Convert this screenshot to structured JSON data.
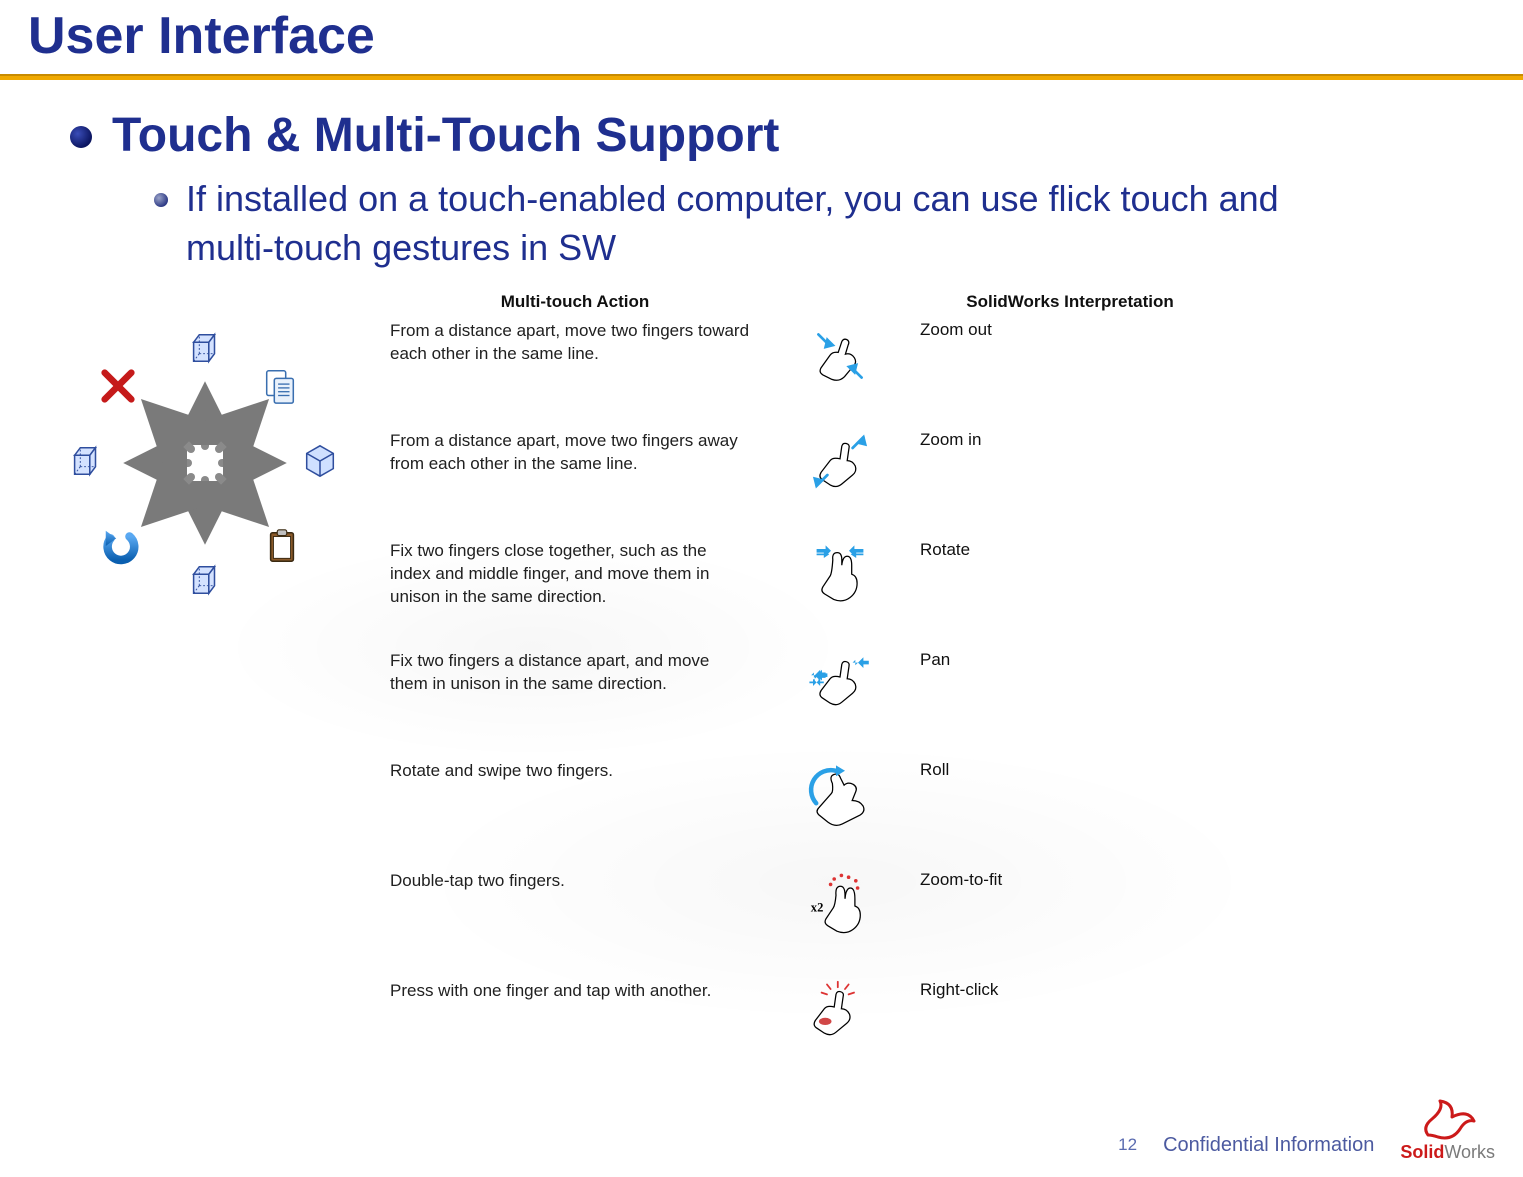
{
  "title": "User Interface",
  "section_heading": "Touch & Multi-Touch Support",
  "sub_bullet": "If installed on a touch-enabled computer, you can use flick touch and multi-touch gestures in SW",
  "table": {
    "header_action": "Multi-touch Action",
    "header_interpret": "SolidWorks Interpretation",
    "rows": [
      {
        "action": "From a distance apart, move two fingers toward each other in the same line.",
        "gesture": "pinch-in",
        "interpret": "Zoom out"
      },
      {
        "action": "From a distance apart, move two fingers away from each other in the same line.",
        "gesture": "pinch-out",
        "interpret": "Zoom in"
      },
      {
        "action": "Fix two fingers close together, such as the index and middle finger, and move them in unison in the same direction.",
        "gesture": "two-finger-drag-close",
        "interpret": "Rotate"
      },
      {
        "action": "Fix two fingers a distance apart, and move them in unison in the same direction.",
        "gesture": "two-finger-drag-apart",
        "interpret": "Pan"
      },
      {
        "action": "Rotate and swipe two fingers.",
        "gesture": "two-finger-rotate",
        "interpret": "Roll"
      },
      {
        "action": "Double-tap two fingers.",
        "gesture": "two-finger-double-tap",
        "badge": "x2",
        "interpret": "Zoom-to-fit"
      },
      {
        "action": "Press with one finger and tap with another.",
        "gesture": "press-and-tap",
        "interpret": "Right-click"
      }
    ]
  },
  "radial_icons": {
    "n": "cube-hidden-icon",
    "ne": "copy-icon",
    "e": "cube-iso-icon",
    "se": "clipboard-icon",
    "s": "cube-hidden-icon",
    "sw": "undo-icon",
    "w": "cube-hidden-icon",
    "nw": "cancel-x-icon"
  },
  "footer": {
    "page_number": "12",
    "confidential": "Confidential Information",
    "brand_red": "Solid",
    "brand_gray": "Works"
  }
}
